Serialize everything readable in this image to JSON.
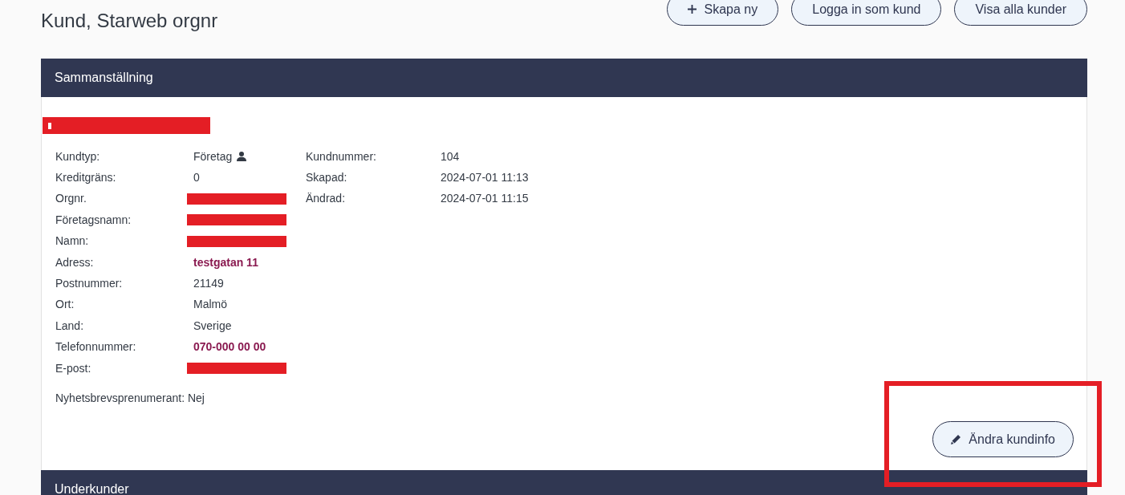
{
  "page": {
    "title": "Kund, Starweb orgnr"
  },
  "toolbar": [
    {
      "label": "Skapa ny",
      "kind": "add"
    },
    {
      "label": "Logga in som kund",
      "kind": "plain"
    },
    {
      "label": "Visa alla kunder",
      "kind": "plain"
    }
  ],
  "summary": {
    "title": "Sammanställning",
    "heading": {
      "kind": "redacted"
    },
    "fields_left": [
      {
        "label": "Kundtyp:",
        "kind": "text_with_person",
        "value": "Företag"
      },
      {
        "label": "Kreditgräns:",
        "kind": "text",
        "value": "0"
      },
      {
        "label": "Orgnr.",
        "kind": "redacted"
      },
      {
        "label": "Företagsnamn:",
        "kind": "redacted"
      },
      {
        "label": "Namn:",
        "kind": "redacted"
      },
      {
        "label": "Adress:",
        "kind": "link",
        "value": "testgatan 11"
      },
      {
        "label": "Postnummer:",
        "kind": "text",
        "value": "21149"
      },
      {
        "label": "Ort:",
        "kind": "text",
        "value": "Malmö"
      },
      {
        "label": "Land:",
        "kind": "text",
        "value": "Sverige"
      },
      {
        "label": "Telefonnummer:",
        "kind": "link",
        "value": "070-000 00 00"
      },
      {
        "label": "E-post:",
        "kind": "redacted"
      }
    ],
    "fields_right": [
      {
        "label": "Kundnummer:",
        "kind": "text",
        "value": "104"
      },
      {
        "label": "Skapad:",
        "kind": "text",
        "value": "2024-07-01 11:13"
      },
      {
        "label": "Ändrad:",
        "kind": "text",
        "value": "2024-07-01 11:15"
      }
    ],
    "newsletter": "Nyhetsbrevsprenumerant: Nej",
    "edit_button": {
      "label": "Ändra kundinfo",
      "highlighted": true
    }
  },
  "subcustomers": {
    "title": "Underkunder"
  }
}
